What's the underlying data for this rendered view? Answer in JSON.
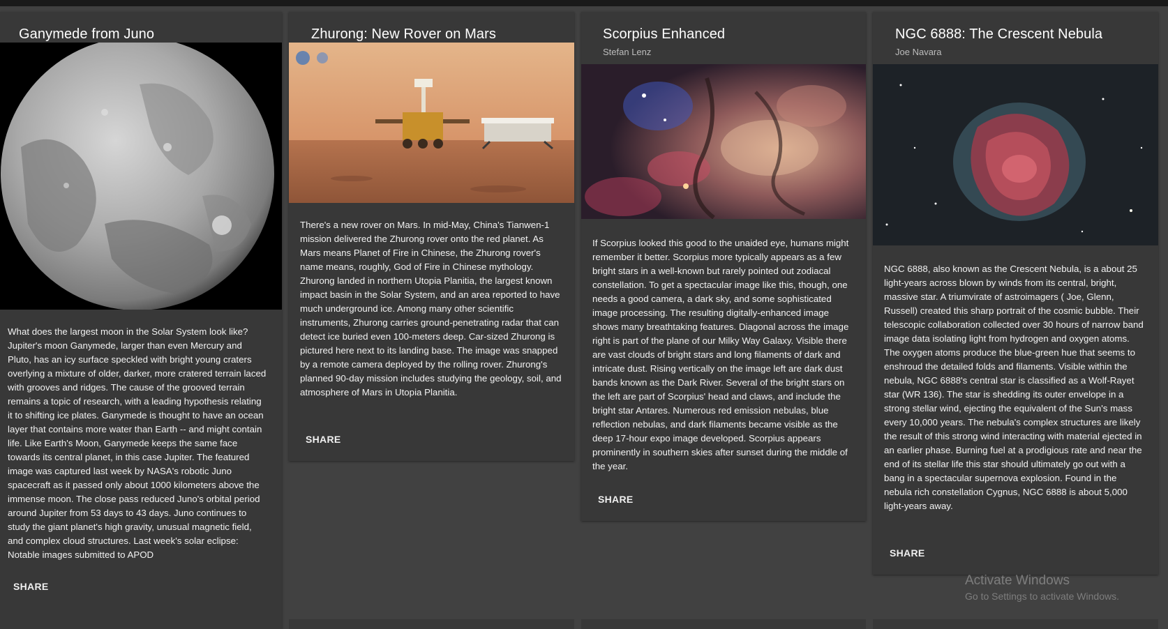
{
  "cards": [
    {
      "title": "Ganymede from Juno",
      "credit": "",
      "image_subject": "ganymede-moon-image",
      "text": "What does the largest moon in the Solar System look like? Jupiter's moon Ganymede, larger than even Mercury and Pluto, has an icy surface speckled with bright young craters overlying a mixture of older, darker, more cratered terrain laced with grooves and ridges. The cause of the grooved terrain remains a topic of research, with a leading hypothesis relating it to shifting ice plates. Ganymede is thought to have an ocean layer that contains more water than Earth -- and might contain life. Like Earth's Moon, Ganymede keeps the same face towards its central planet, in this case Jupiter. The featured image was captured last week by NASA's robotic Juno spacecraft as it passed only about 1000 kilometers above the immense moon. The close pass reduced Juno's orbital period around Jupiter from 53 days to 43 days. Juno continues to study the giant planet's high gravity, unusual magnetic field, and complex cloud structures. Last week's solar eclipse: Notable images submitted to APOD",
      "share": "SHARE"
    },
    {
      "title": "Zhurong: New Rover on Mars",
      "credit": "",
      "image_subject": "zhurong-rover-image",
      "text": "There's a new rover on Mars. In mid-May, China's Tianwen-1 mission delivered the Zhurong rover onto the red planet. As Mars means Planet of Fire in Chinese, the Zhurong rover's name means, roughly, God of Fire in Chinese mythology. Zhurong landed in northern Utopia Planitia, the largest known impact basin in the Solar System, and an area reported to have much underground ice. Among many other scientific instruments, Zhurong carries ground-penetrating radar that can detect ice buried even 100-meters deep. Car-sized Zhurong is pictured here next to its landing base. The image was snapped by a remote camera deployed by the rolling rover. Zhurong's planned 90-day mission includes studying the geology, soil, and atmosphere of Mars in Utopia Planitia.",
      "share": "SHARE"
    },
    {
      "title": "Scorpius Enhanced",
      "credit": "Stefan Lenz",
      "image_subject": "scorpius-milky-way-image",
      "text": "If Scorpius looked this good to the unaided eye, humans might remember it better. Scorpius more typically appears as a few bright stars in a well-known but rarely pointed out zodiacal constellation. To get a spectacular image like this, though, one needs a good camera, a dark sky, and some sophisticated image processing. The resulting digitally-enhanced image shows many breathtaking features. Diagonal across the image right is part of the plane of our Milky Way Galaxy. Visible there are vast clouds of bright stars and long filaments of dark and intricate dust. Rising vertically on the image left are dark dust bands known as the Dark River. Several of the bright stars on the left are part of Scorpius' head and claws, and include the bright star Antares. Numerous red emission nebulas, blue reflection nebulas, and dark filaments became visible as the deep 17-hour expo image developed. Scorpius appears prominently in southern skies after sunset during the middle of the year.",
      "share": "SHARE"
    },
    {
      "title": "NGC 6888: The Crescent Nebula",
      "credit": "Joe Navara",
      "image_subject": "crescent-nebula-image",
      "text": "NGC 6888, also known as the Crescent Nebula, is a about 25 light-years across blown by winds from its central, bright, massive star. A triumvirate of astroimagers ( Joe, Glenn, Russell) created this sharp portrait of the cosmic bubble. Their telescopic collaboration collected over 30 hours of narrow band image data isolating light from hydrogen and oxygen atoms. The oxygen atoms produce the blue-green hue that seems to enshroud the detailed folds and filaments. Visible within the nebula, NGC 6888's central star is classified as a Wolf-Rayet star (WR 136). The star is shedding its outer envelope in a strong stellar wind, ejecting the equivalent of the Sun's mass every 10,000 years. The nebula's complex structures are likely the result of this strong wind interacting with material ejected in an earlier phase. Burning fuel at a prodigious rate and near the end of its stellar life this star should ultimately go out with a bang in a spectacular supernova explosion. Found in the nebula rich constellation Cygnus, NGC 6888 is about 5,000 light-years away.",
      "share": "SHARE"
    }
  ],
  "watermark": {
    "title": "Activate Windows",
    "subtitle": "Go to Settings to activate Windows."
  },
  "colors": {
    "page_background": "#414141",
    "card_background": "#383838",
    "text": "#ffffff"
  }
}
